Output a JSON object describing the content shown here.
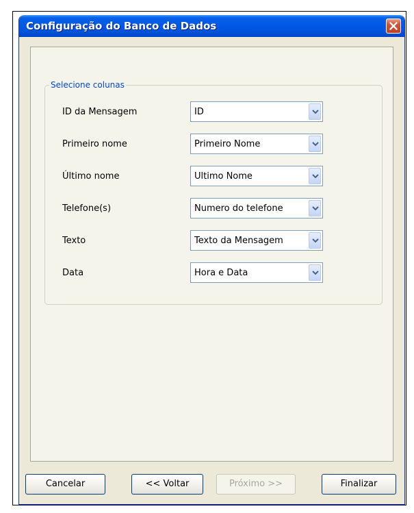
{
  "window": {
    "title": "Configuração do Banco de Dados"
  },
  "group": {
    "legend": "Selecione colunas",
    "rows": [
      {
        "label": "ID da Mensagem",
        "value": "ID"
      },
      {
        "label": "Primeiro nome",
        "value": "Primeiro Nome"
      },
      {
        "label": "Último nome",
        "value": "Ultimo Nome"
      },
      {
        "label": "Telefone(s)",
        "value": "Numero do telefone"
      },
      {
        "label": "Texto",
        "value": "Texto da Mensagem"
      },
      {
        "label": "Data",
        "value": "Hora e Data"
      }
    ]
  },
  "buttons": {
    "cancel": "Cancelar",
    "back": "<< Voltar",
    "next": "Próximo >>",
    "finish": "Finalizar"
  },
  "colors": {
    "titlebar": "#0058e6",
    "legend": "#0046d5",
    "close": "#c1401f"
  },
  "icons": {
    "close": "close-icon",
    "dropdown": "chevron-down-icon"
  }
}
